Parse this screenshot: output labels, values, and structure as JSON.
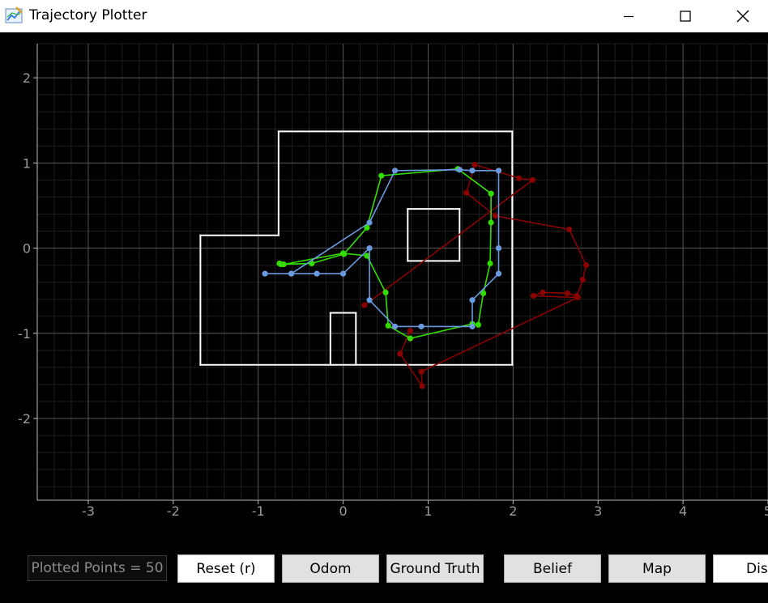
{
  "window": {
    "title": "Trajectory Plotter",
    "controls": [
      "minimize",
      "maximize",
      "close"
    ]
  },
  "footer": {
    "counter_label": "Plotted Points = 50",
    "buttons": {
      "reset": "Reset (r)",
      "odom": "Odom",
      "ground_truth": "Ground Truth",
      "belief": "Belief",
      "map": "Map",
      "dist": "Dis"
    }
  },
  "colors": {
    "background": "#000000",
    "grid_major": "#555555",
    "grid_minor": "#1e1e1e",
    "axis_text": "#9a9a9a",
    "map": "#ffffff",
    "odom": "#8b0000",
    "ground_truth": "#33dd00",
    "belief": "#6a9ae0"
  },
  "chart_data": {
    "type": "line",
    "xlim": [
      -3.6,
      5
    ],
    "ylim": [
      -2.95,
      2.4
    ],
    "x_ticks": [
      "-3",
      "-2",
      "-1",
      "0",
      "1",
      "2",
      "3",
      "4",
      "5"
    ],
    "y_ticks": [
      "2",
      "1",
      "0",
      "-1",
      "-2"
    ],
    "grid": true,
    "map_segments": [
      [
        [
          -1.68,
          0.15
        ],
        [
          -0.76,
          0.15
        ]
      ],
      [
        [
          -0.76,
          0.15
        ],
        [
          -0.76,
          1.37
        ]
      ],
      [
        [
          -0.76,
          1.37
        ],
        [
          1.99,
          1.37
        ]
      ],
      [
        [
          1.99,
          1.37
        ],
        [
          1.99,
          -1.37
        ]
      ],
      [
        [
          1.99,
          -1.37
        ],
        [
          -1.68,
          -1.37
        ]
      ],
      [
        [
          -1.68,
          -1.37
        ],
        [
          -1.68,
          0.15
        ]
      ],
      [
        [
          0.76,
          0.46
        ],
        [
          1.37,
          0.46
        ]
      ],
      [
        [
          1.37,
          0.46
        ],
        [
          1.37,
          -0.15
        ]
      ],
      [
        [
          1.37,
          -0.15
        ],
        [
          0.76,
          -0.15
        ]
      ],
      [
        [
          0.76,
          -0.15
        ],
        [
          0.76,
          0.46
        ]
      ],
      [
        [
          -0.15,
          -1.37
        ],
        [
          -0.15,
          -0.76
        ]
      ],
      [
        [
          -0.15,
          -0.76
        ],
        [
          0.15,
          -0.76
        ]
      ],
      [
        [
          0.15,
          -0.76
        ],
        [
          0.15,
          -1.37
        ]
      ]
    ],
    "series": [
      {
        "color": "#8b0000",
        "points": [
          [
            0.25,
            -0.67
          ],
          [
            2.23,
            0.8
          ],
          [
            2.07,
            0.82
          ],
          [
            1.55,
            0.98
          ],
          [
            1.45,
            0.65
          ],
          [
            1.79,
            0.38
          ],
          [
            2.66,
            0.22
          ],
          [
            2.86,
            -0.2
          ],
          [
            2.82,
            -0.37
          ],
          [
            2.75,
            -0.56
          ],
          [
            2.64,
            -0.53
          ],
          [
            2.35,
            -0.52
          ],
          [
            2.24,
            -0.56
          ],
          [
            2.76,
            -0.58
          ],
          [
            0.92,
            -1.45
          ],
          [
            0.93,
            -1.62
          ],
          [
            0.67,
            -1.24
          ],
          [
            0.79,
            -0.97
          ]
        ]
      },
      {
        "color": "#33dd00",
        "points": [
          [
            -0.75,
            -0.18
          ],
          [
            -0.73,
            -0.19
          ],
          [
            -0.37,
            -0.18
          ],
          [
            0.01,
            -0.07
          ],
          [
            0.28,
            0.24
          ],
          [
            0.45,
            0.85
          ],
          [
            1.35,
            0.93
          ],
          [
            1.74,
            0.64
          ],
          [
            1.74,
            0.3
          ],
          [
            1.73,
            -0.18
          ],
          [
            1.65,
            -0.53
          ],
          [
            1.59,
            -0.9
          ],
          [
            1.52,
            -0.89
          ],
          [
            0.79,
            -1.06
          ],
          [
            0.53,
            -0.91
          ],
          [
            0.5,
            -0.52
          ],
          [
            0.28,
            -0.09
          ],
          [
            0.0,
            -0.06
          ],
          [
            -0.7,
            -0.19
          ]
        ]
      },
      {
        "color": "#6a9ae0",
        "points": [
          [
            -0.92,
            -0.3
          ],
          [
            -0.61,
            -0.3
          ],
          [
            -0.31,
            -0.3
          ],
          [
            0.0,
            -0.3
          ],
          [
            0.31,
            0.0
          ],
          [
            0.31,
            -0.61
          ],
          [
            0.61,
            -0.92
          ],
          [
            0.92,
            -0.92
          ],
          [
            1.52,
            -0.92
          ],
          [
            1.52,
            -0.61
          ],
          [
            1.83,
            -0.3
          ],
          [
            1.83,
            0.0
          ],
          [
            1.83,
            0.91
          ],
          [
            1.52,
            0.91
          ],
          [
            1.37,
            0.92
          ],
          [
            0.61,
            0.91
          ],
          [
            0.31,
            0.3
          ],
          [
            -0.61,
            -0.3
          ]
        ]
      }
    ]
  }
}
